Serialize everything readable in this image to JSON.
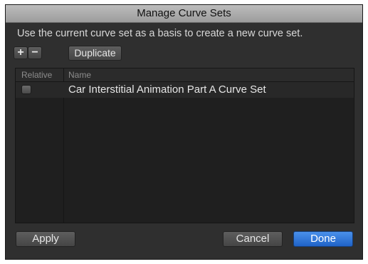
{
  "dialog": {
    "title": "Manage Curve Sets",
    "instruction": "Use the current curve set as a basis to create a new curve set."
  },
  "toolbar": {
    "add_label": "+",
    "remove_label": "−",
    "duplicate_label": "Duplicate"
  },
  "table": {
    "columns": [
      "Relative",
      "Name"
    ],
    "rows": [
      {
        "relative": false,
        "name": "Car Interstitial Animation Part A Curve Set"
      }
    ]
  },
  "footer": {
    "apply_label": "Apply",
    "cancel_label": "Cancel",
    "done_label": "Done"
  },
  "colors": {
    "dialog_bg": "#2f2f2f",
    "done_button": "#2f73d8"
  }
}
